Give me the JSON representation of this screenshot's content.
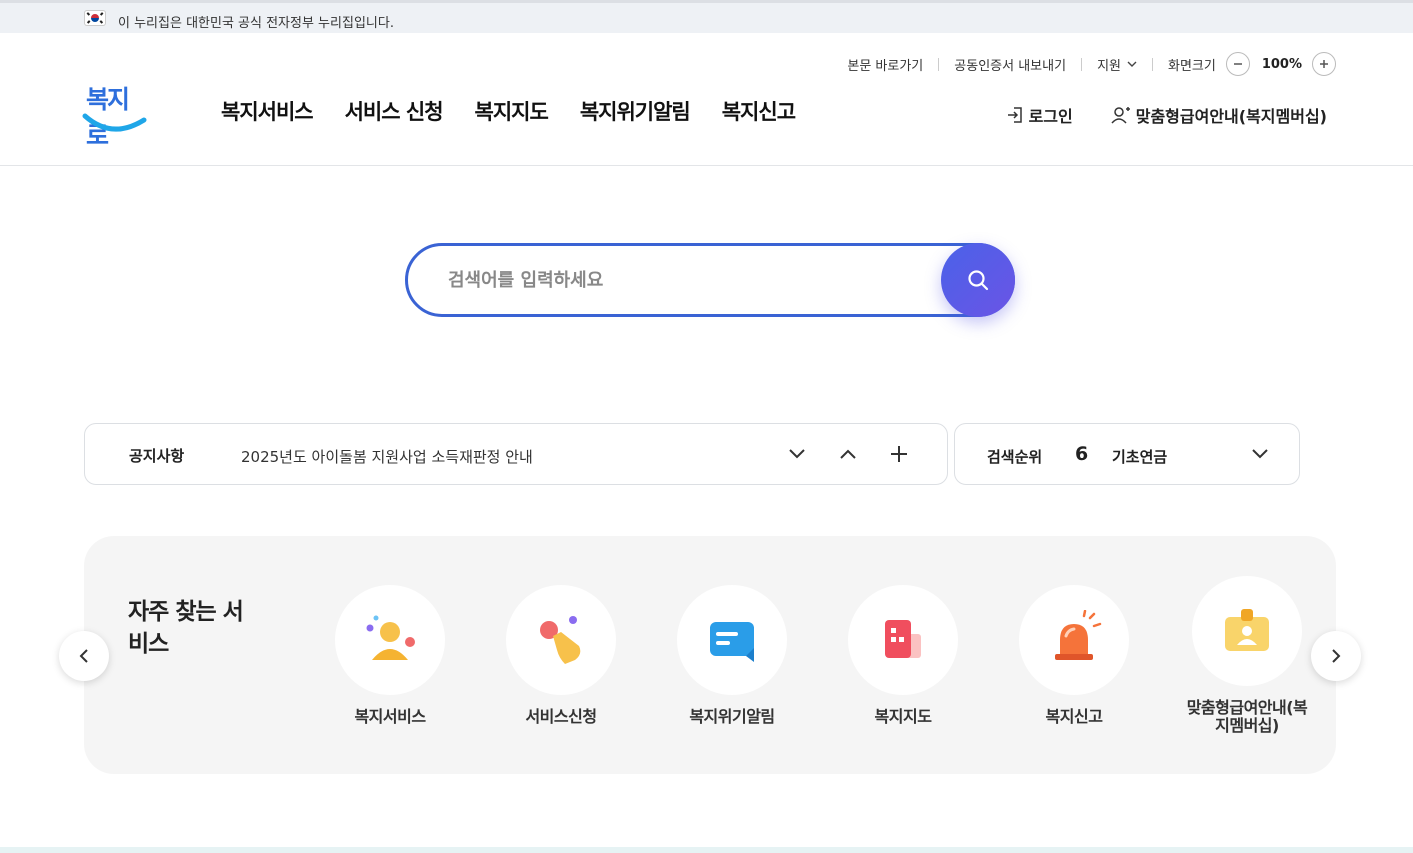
{
  "gov_banner": {
    "text": "이 누리집은 대한민국 공식 전자정부 누리집입니다."
  },
  "utility": {
    "skip_to_content": "본문 바로가기",
    "cert_export": "공동인증서 내보내기",
    "support": "지원",
    "screen_size": "화면크기",
    "zoom_level": "100%"
  },
  "logo": {
    "text": "복지로"
  },
  "gnb": {
    "items": [
      {
        "label": "복지서비스"
      },
      {
        "label": "서비스 신청"
      },
      {
        "label": "복지지도"
      },
      {
        "label": "복지위기알림"
      },
      {
        "label": "복지신고"
      }
    ]
  },
  "header_right": {
    "login": "로그인",
    "membership": "맞춤형급여안내(복지멤버십)"
  },
  "search": {
    "placeholder": "검색어를 입력하세요"
  },
  "notice": {
    "label": "공지사항",
    "text": "2025년도 아이돌봄 지원사업 소득재판정 안내"
  },
  "ranking": {
    "label": "검색순위",
    "rank": "6",
    "term": "기초연금"
  },
  "frequent": {
    "title": "자주 찾는 서비스",
    "items": [
      {
        "label": "복지서비스",
        "icon": "person-icon"
      },
      {
        "label": "서비스신청",
        "icon": "hand-tap-icon"
      },
      {
        "label": "복지위기알림",
        "icon": "message-icon"
      },
      {
        "label": "복지지도",
        "icon": "map-building-icon"
      },
      {
        "label": "복지신고",
        "icon": "siren-icon"
      },
      {
        "label": "맞춤형급여안내(복지멤버십)",
        "icon": "id-card-icon"
      }
    ]
  },
  "colors": {
    "brand_blue": "#3a63d4",
    "search_button": "#5a5be7",
    "text_dark": "#222222"
  }
}
